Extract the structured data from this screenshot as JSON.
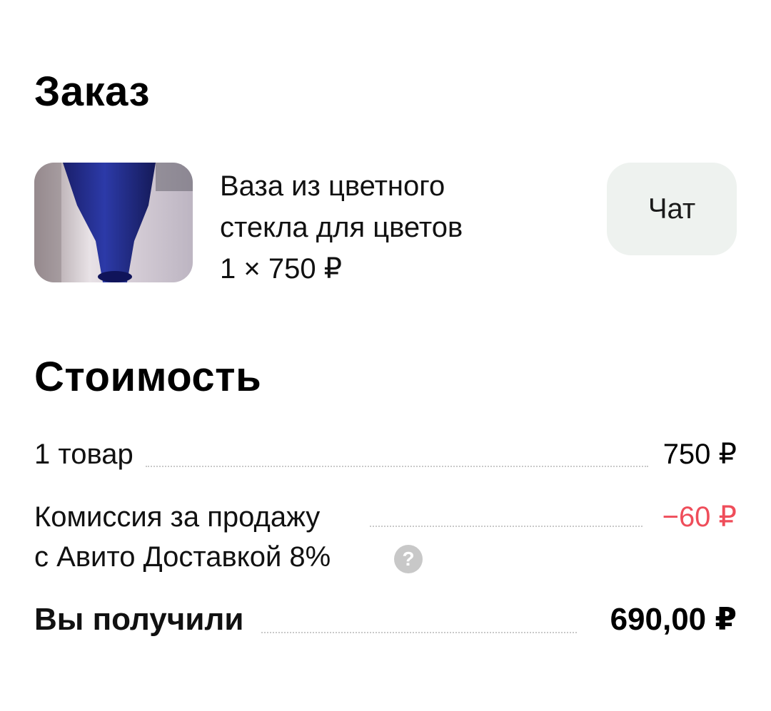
{
  "order": {
    "title": "Заказ",
    "item": {
      "name_line1": "Ваза из цветного",
      "name_line2": "стекла для цветов",
      "qty_price": "1 × 750 ₽",
      "thumbnail_icon": "vase-photo"
    },
    "chat_label": "Чат"
  },
  "cost": {
    "title": "Стоимость",
    "goods": {
      "label": "1 товар",
      "value": "750 ₽"
    },
    "fee": {
      "label_line1": "Комиссия за продажу",
      "label_line2": "с Авито Доставкой 8%",
      "value": "−60 ₽",
      "help_icon": "?",
      "value_color": "#ef4d5a"
    },
    "total": {
      "label": "Вы получили",
      "value": "690,00 ₽"
    }
  }
}
